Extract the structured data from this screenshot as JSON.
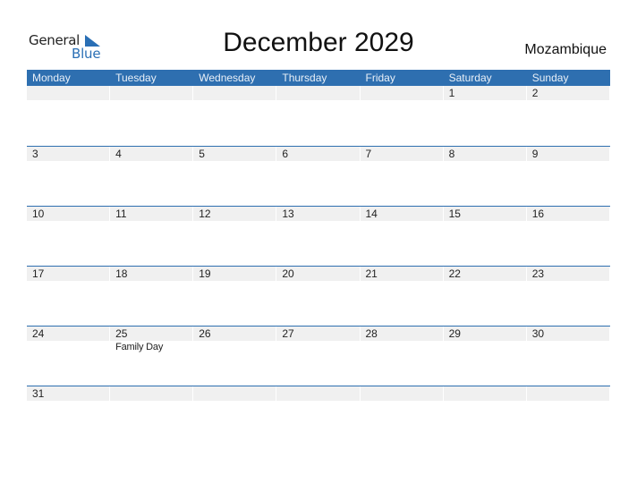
{
  "logo": {
    "line1": "General",
    "line2": "Blue",
    "icon": "triangle-flag-icon"
  },
  "title": "December 2029",
  "country": "Mozambique",
  "colors": {
    "accent": "#2e6fb0",
    "date_strip": "#f0f0f0",
    "logo_blue": "#2a6fb5"
  },
  "weekdays": [
    "Monday",
    "Tuesday",
    "Wednesday",
    "Thursday",
    "Friday",
    "Saturday",
    "Sunday"
  ],
  "weeks": [
    {
      "days": [
        {
          "d": ""
        },
        {
          "d": ""
        },
        {
          "d": ""
        },
        {
          "d": ""
        },
        {
          "d": ""
        },
        {
          "d": "1"
        },
        {
          "d": "2"
        }
      ]
    },
    {
      "days": [
        {
          "d": "3"
        },
        {
          "d": "4"
        },
        {
          "d": "5"
        },
        {
          "d": "6"
        },
        {
          "d": "7"
        },
        {
          "d": "8"
        },
        {
          "d": "9"
        }
      ]
    },
    {
      "days": [
        {
          "d": "10"
        },
        {
          "d": "11"
        },
        {
          "d": "12"
        },
        {
          "d": "13"
        },
        {
          "d": "14"
        },
        {
          "d": "15"
        },
        {
          "d": "16"
        }
      ]
    },
    {
      "days": [
        {
          "d": "17"
        },
        {
          "d": "18"
        },
        {
          "d": "19"
        },
        {
          "d": "20"
        },
        {
          "d": "21"
        },
        {
          "d": "22"
        },
        {
          "d": "23"
        }
      ]
    },
    {
      "days": [
        {
          "d": "24"
        },
        {
          "d": "25",
          "event": "Family Day"
        },
        {
          "d": "26"
        },
        {
          "d": "27"
        },
        {
          "d": "28"
        },
        {
          "d": "29"
        },
        {
          "d": "30"
        }
      ]
    },
    {
      "days": [
        {
          "d": "31"
        },
        {
          "d": ""
        },
        {
          "d": ""
        },
        {
          "d": ""
        },
        {
          "d": ""
        },
        {
          "d": ""
        },
        {
          "d": ""
        }
      ]
    }
  ]
}
